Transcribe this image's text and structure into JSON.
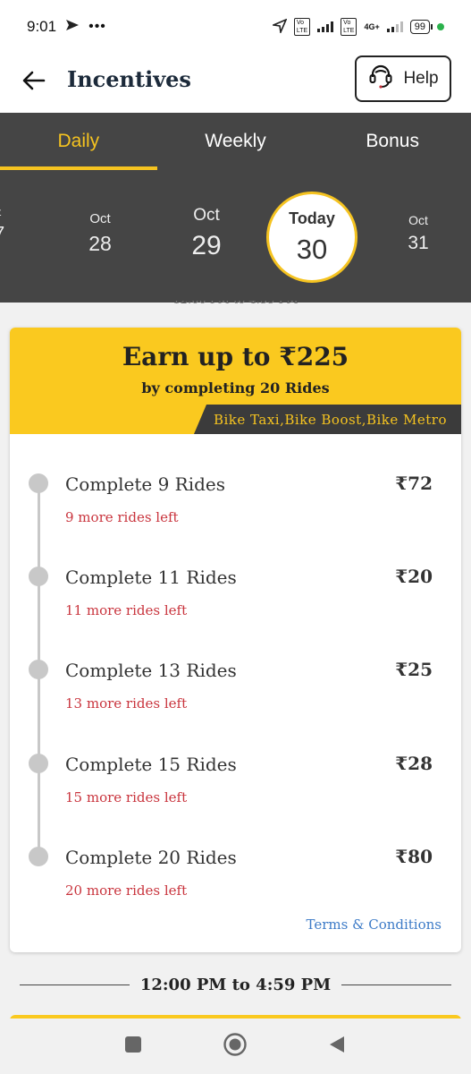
{
  "status": {
    "time": "9:01",
    "network": "4G+",
    "battery": "99"
  },
  "header": {
    "title": "Incentives",
    "help_label": "Help"
  },
  "tabs": [
    {
      "label": "Daily",
      "active": true
    },
    {
      "label": "Weekly",
      "active": false
    },
    {
      "label": "Bonus",
      "active": false
    }
  ],
  "dates": {
    "prev_partial": {
      "month": "t",
      "day": "7"
    },
    "d28": {
      "month": "Oct",
      "day": "28"
    },
    "d29": {
      "month": "Oct",
      "day": "29"
    },
    "today": {
      "month": "Today",
      "day": "30"
    },
    "d31": {
      "month": "Oct",
      "day": "31"
    }
  },
  "card": {
    "earn_title": "Earn up to ₹225",
    "earn_subtitle": "by completing 20 Rides",
    "services": "Bike Taxi,Bike Boost,Bike Metro",
    "milestones": [
      {
        "title": "Complete 9 Rides",
        "amount": "₹72",
        "left": "9 more rides left"
      },
      {
        "title": "Complete 11 Rides",
        "amount": "₹20",
        "left": "11 more rides left"
      },
      {
        "title": "Complete 13 Rides",
        "amount": "₹25",
        "left": "13 more rides left"
      },
      {
        "title": "Complete 15 Rides",
        "amount": "₹28",
        "left": "15 more rides left"
      },
      {
        "title": "Complete 20 Rides",
        "amount": "₹80",
        "left": "20 more rides left"
      }
    ],
    "terms_label": "Terms & Conditions"
  },
  "next_slot": {
    "time_range": "12:00 PM to 4:59 PM"
  },
  "colors": {
    "accent": "#fac91f",
    "dark": "#454545",
    "alert": "#c9343d",
    "link": "#3d7bc7"
  },
  "icons": {
    "back": "arrow-left-icon",
    "help": "headset-icon",
    "nav_recent": "square-icon",
    "nav_home": "circle-icon",
    "nav_back": "triangle-icon"
  }
}
